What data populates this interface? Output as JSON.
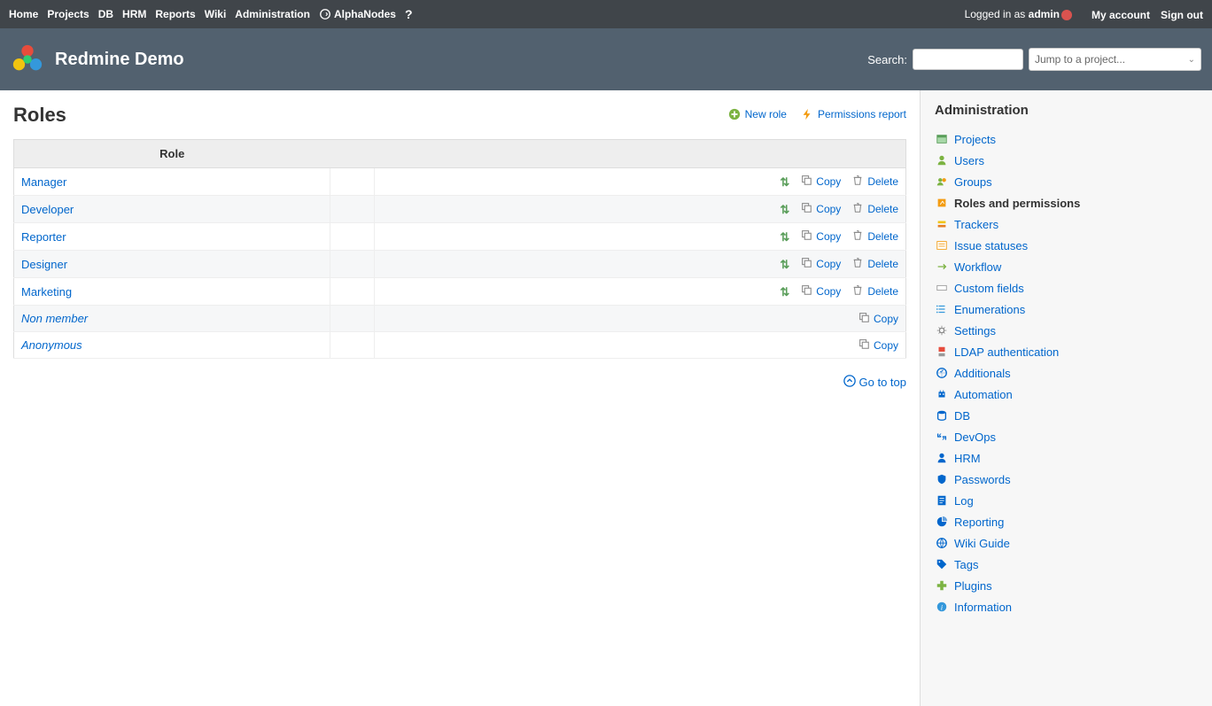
{
  "top_menu": {
    "left": [
      "Home",
      "Projects",
      "DB",
      "HRM",
      "Reports",
      "Wiki",
      "Administration"
    ],
    "alphanodes": "AlphaNodes",
    "logged_prefix": "Logged in as ",
    "username": "admin",
    "right": [
      "My account",
      "Sign out"
    ]
  },
  "header": {
    "title": "Redmine Demo",
    "search_label": "Search:",
    "project_jump": "Jump to a project..."
  },
  "page": {
    "title": "Roles",
    "new_role": "New role",
    "permissions_report": "Permissions report",
    "go_to_top": "Go to top"
  },
  "table": {
    "header": "Role",
    "copy_label": "Copy",
    "delete_label": "Delete",
    "rows": [
      {
        "name": "Manager",
        "builtin": false,
        "deletable": true
      },
      {
        "name": "Developer",
        "builtin": false,
        "deletable": true
      },
      {
        "name": "Reporter",
        "builtin": false,
        "deletable": true
      },
      {
        "name": "Designer",
        "builtin": false,
        "deletable": true
      },
      {
        "name": "Marketing",
        "builtin": false,
        "deletable": true
      },
      {
        "name": "Non member",
        "builtin": true,
        "deletable": false
      },
      {
        "name": "Anonymous",
        "builtin": true,
        "deletable": false
      }
    ]
  },
  "sidebar": {
    "title": "Administration",
    "items": [
      {
        "label": "Projects",
        "icon": "projects",
        "selected": false
      },
      {
        "label": "Users",
        "icon": "users",
        "selected": false
      },
      {
        "label": "Groups",
        "icon": "groups",
        "selected": false
      },
      {
        "label": "Roles and permissions",
        "icon": "roles",
        "selected": true
      },
      {
        "label": "Trackers",
        "icon": "trackers",
        "selected": false
      },
      {
        "label": "Issue statuses",
        "icon": "statuses",
        "selected": false
      },
      {
        "label": "Workflow",
        "icon": "workflow",
        "selected": false
      },
      {
        "label": "Custom fields",
        "icon": "fields",
        "selected": false
      },
      {
        "label": "Enumerations",
        "icon": "enum",
        "selected": false
      },
      {
        "label": "Settings",
        "icon": "settings",
        "selected": false
      },
      {
        "label": "LDAP authentication",
        "icon": "ldap",
        "selected": false
      },
      {
        "label": "Additionals",
        "icon": "additionals",
        "selected": false
      },
      {
        "label": "Automation",
        "icon": "automation",
        "selected": false
      },
      {
        "label": "DB",
        "icon": "db",
        "selected": false
      },
      {
        "label": "DevOps",
        "icon": "devops",
        "selected": false
      },
      {
        "label": "HRM",
        "icon": "hrm",
        "selected": false
      },
      {
        "label": "Passwords",
        "icon": "passwords",
        "selected": false
      },
      {
        "label": "Log",
        "icon": "log",
        "selected": false
      },
      {
        "label": "Reporting",
        "icon": "reporting",
        "selected": false
      },
      {
        "label": "Wiki Guide",
        "icon": "wiki",
        "selected": false
      },
      {
        "label": "Tags",
        "icon": "tags",
        "selected": false
      },
      {
        "label": "Plugins",
        "icon": "plugins",
        "selected": false
      },
      {
        "label": "Information",
        "icon": "info",
        "selected": false
      }
    ]
  }
}
